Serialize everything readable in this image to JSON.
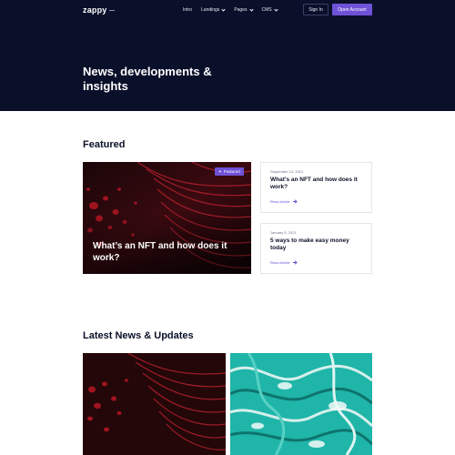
{
  "header": {
    "logo": "zappy",
    "nav": [
      {
        "label": "Intro",
        "dropdown": false
      },
      {
        "label": "Landings",
        "dropdown": true
      },
      {
        "label": "Pages",
        "dropdown": true
      },
      {
        "label": "CMS",
        "dropdown": true
      }
    ],
    "signin_label": "Sign In",
    "open_account_label": "Open Account"
  },
  "hero": {
    "title": "News, developments & insights"
  },
  "featured": {
    "section_title": "Featured",
    "main": {
      "badge": "Featured",
      "title": "What’s an NFT and how does it work?"
    },
    "side": [
      {
        "date": "September 14, 2021",
        "title": "What’s an NFT and how does it work?",
        "link": "Read Article"
      },
      {
        "date": "January 5, 2021",
        "title": "5 ways to make easy money today",
        "link": "Read Article"
      }
    ]
  },
  "latest": {
    "section_title": "Latest News & Updates"
  },
  "colors": {
    "hero_bg": "#0a0f2a",
    "accent": "#6f52d8",
    "text": "#0b1027"
  }
}
